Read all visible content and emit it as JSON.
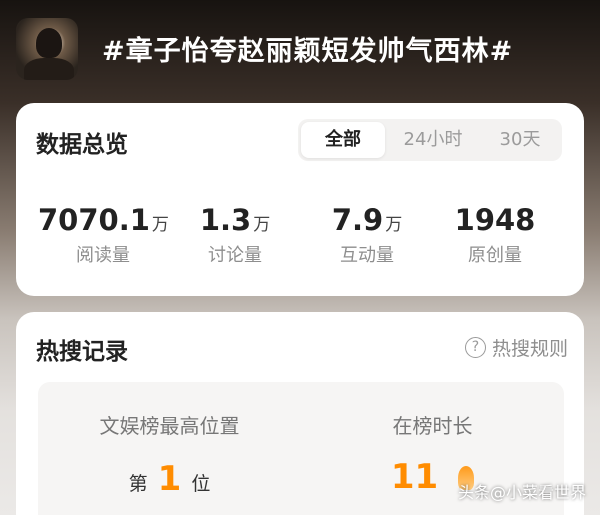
{
  "topic": {
    "title": "#章子怡夸赵丽颖短发帅气西林#",
    "thumbnail_icon": "topic-thumbnail"
  },
  "overview": {
    "title": "数据总览",
    "tabs": [
      {
        "label": "全部",
        "active": true
      },
      {
        "label": "24小时",
        "active": false
      },
      {
        "label": "30天",
        "active": false
      }
    ],
    "stats": [
      {
        "value": "7070.1",
        "unit": "万",
        "label": "阅读量"
      },
      {
        "value": "1.3",
        "unit": "万",
        "label": "讨论量"
      },
      {
        "value": "7.9",
        "unit": "万",
        "label": "互动量"
      },
      {
        "value": "1948",
        "unit": "",
        "label": "原创量"
      }
    ]
  },
  "hot": {
    "title": "热搜记录",
    "rules_label": "热搜规则",
    "highest_caption": "文娱榜最高位置",
    "rank_prefix": "第",
    "rank_value": "1",
    "rank_suffix": "位",
    "duration_caption": "在榜时长",
    "duration_value": "11"
  },
  "watermark": "头条@小菜看世界",
  "colors": {
    "accent": "#ff8c00",
    "card_bg": "#ffffff"
  }
}
